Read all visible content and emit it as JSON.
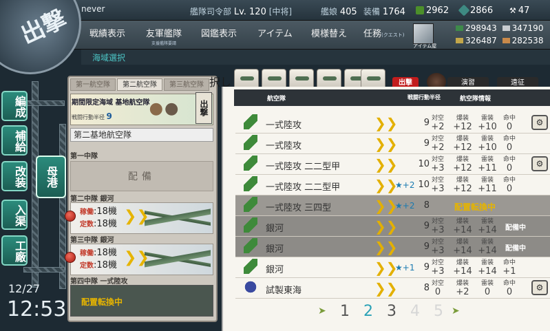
{
  "header": {
    "admiral_name": "never",
    "hq_label": "艦隊司令部",
    "level_text": "Lv. 120",
    "rank": "[中将]",
    "ship_label": "艦娘",
    "ship_count": "405",
    "equip_label": "装備",
    "equip_count": "1764",
    "coin": "2962",
    "bucket": "2866",
    "hammer": "47",
    "fuel": "298943",
    "steel": "347190",
    "ammo": "326487",
    "bauxite": "282538"
  },
  "menu": {
    "items": [
      "戦績表示",
      "友軍艦隊",
      "図鑑表示",
      "アイテム",
      "模様替え",
      "任務"
    ],
    "friend_sub": "支援艦隊要請",
    "quest_sub": "(クエスト)",
    "shop_label": "アイテム屋"
  },
  "logo_text": "出撃",
  "sea_area": "海域選択",
  "nav": {
    "items": [
      "編成",
      "補給",
      "改装",
      "入渠",
      "工廠"
    ],
    "hub": "母港"
  },
  "datetime": {
    "date": "12/27",
    "time": "12:53"
  },
  "left_panel": {
    "tabs": [
      "第一航空隊",
      "第二航空隊",
      "第三航空隊"
    ],
    "banner_title": "期間限定海域 基地航空隊",
    "range_label": "戦闘行動半径",
    "range_value": "9",
    "sortie_label": "出撃",
    "corps_name": "第二基地航空隊",
    "squadrons": [
      {
        "label": "第一中隊",
        "state": "配備"
      },
      {
        "label": "第二中隊 銀河",
        "active_label": "稼働",
        "active": ":18機",
        "count_label": "定数",
        "count": ":18機"
      },
      {
        "label": "第三中隊 銀河",
        "active_label": "稼働",
        "active": ":18機",
        "count_label": "定数",
        "count": ":18機"
      },
      {
        "label": "第四中隊 一式陸攻",
        "state": "配置転換中"
      }
    ]
  },
  "list_panel": {
    "sort_label": "択し",
    "buttons": [
      "出撃",
      "演習",
      "遠征"
    ],
    "headers": {
      "squadron": "航空隊",
      "range": "戦闘行動半径",
      "info": "航空隊情報"
    },
    "stat_labels": [
      "対空",
      "爆装",
      "雷装",
      "命中"
    ],
    "rows": [
      {
        "name": "一式陸攻",
        "plus": "",
        "range": "9",
        "aa": "+2",
        "bomb": "+12",
        "torp": "+10",
        "acc": "0",
        "badge": "",
        "reloc": "",
        "gear": true,
        "style": "normal"
      },
      {
        "name": "一式陸攻",
        "plus": "",
        "range": "9",
        "aa": "+2",
        "bomb": "+12",
        "torp": "+10",
        "acc": "0",
        "badge": "",
        "reloc": "",
        "gear": false,
        "style": "normal"
      },
      {
        "name": "一式陸攻 二二型甲",
        "plus": "",
        "range": "10",
        "aa": "+3",
        "bomb": "+12",
        "torp": "+11",
        "acc": "0",
        "badge": "",
        "reloc": "",
        "gear": true,
        "style": "normal"
      },
      {
        "name": "一式陸攻 二二型甲",
        "plus": "★+2",
        "range": "10",
        "aa": "+3",
        "bomb": "+12",
        "torp": "+11",
        "acc": "0",
        "badge": "",
        "reloc": "",
        "gear": false,
        "style": "normal"
      },
      {
        "name": "一式陸攻 三四型",
        "plus": "★+2",
        "range": "8",
        "aa": "",
        "bomb": "",
        "torp": "",
        "acc": "",
        "badge": "",
        "reloc": "配置転換中",
        "gear": false,
        "style": "hi"
      },
      {
        "name": "銀河",
        "plus": "",
        "range": "9",
        "aa": "+3",
        "bomb": "+14",
        "torp": "+14",
        "acc": "",
        "badge": "配備中",
        "reloc": "",
        "gear": false,
        "style": "dim"
      },
      {
        "name": "銀河",
        "plus": "",
        "range": "9",
        "aa": "+3",
        "bomb": "+14",
        "torp": "+14",
        "acc": "",
        "badge": "配備中",
        "reloc": "",
        "gear": false,
        "style": "dim"
      },
      {
        "name": "銀河",
        "plus": "★+1",
        "range": "9",
        "aa": "+3",
        "bomb": "+14",
        "torp": "+14",
        "acc": "+1",
        "badge": "",
        "reloc": "",
        "gear": false,
        "style": "normal"
      },
      {
        "name": "試製東海",
        "plus": "",
        "range": "8",
        "aa": "0",
        "bomb": "+2",
        "torp": "0",
        "acc": "0",
        "badge": "",
        "reloc": "",
        "gear": true,
        "style": "normal"
      }
    ],
    "pages": [
      "1",
      "2",
      "3",
      "4",
      "5"
    ],
    "current_page": "2"
  }
}
